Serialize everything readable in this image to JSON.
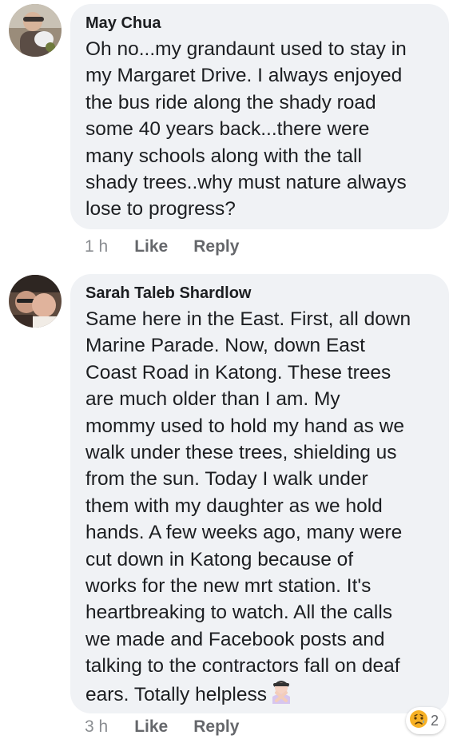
{
  "comments": [
    {
      "author": "May Chua",
      "text": "Oh no...my grandaunt used to stay in\nmy Margaret Drive. I always enjoyed\nthe bus ride along the shady road\nsome 40 years back...there were\nmany schools along with the tall\nshady trees..why must nature always\nlose to progress?",
      "time": "1 h",
      "like_label": "Like",
      "reply_label": "Reply"
    },
    {
      "author": "Sarah Taleb Shardlow",
      "text": "Same here in the East. First, all down\nMarine Parade. Now, down East\nCoast Road in Katong. These trees\nare much older than I am. My\nmommy used to hold my hand as we\nwalk under these trees, shielding us\nfrom the sun. Today I walk under\nthem with my daughter as we hold\nhands. A few weeks ago, many were\ncut down in Katong because of\nworks for the new mrt station. It's\nheartbreaking to watch. All the calls\nwe made and Facebook posts and\ntalking to the contractors fall on deaf\nears. Totally helpless",
      "trailing_emoji": "person-gesturing-no-emoji",
      "time": "3 h",
      "like_label": "Like",
      "reply_label": "Reply",
      "reactions": {
        "icon": "sad-face-emoji",
        "count": "2"
      }
    }
  ],
  "colors": {
    "bubble": "#f0f2f5",
    "meta_text": "#65676b",
    "text": "#1c1e21"
  }
}
